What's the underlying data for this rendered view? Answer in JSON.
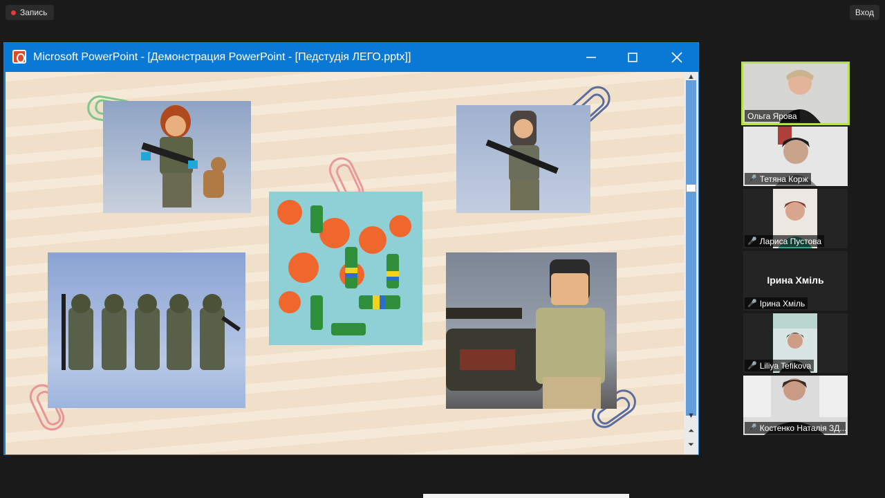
{
  "meeting": {
    "record_label": "Запись",
    "enter_label": "Вход"
  },
  "window": {
    "title": "Microsoft PowerPoint - [Демонстрация PowerPoint - [Педстудія ЛЕГО.pptx]]",
    "minimize_icon": "minimize-icon",
    "maximize_icon": "maximize-icon",
    "close_icon": "close-icon"
  },
  "participants": [
    {
      "name": "Ольга Ярова",
      "muted": false,
      "active": true
    },
    {
      "name": "Тетяна Корж",
      "muted": true
    },
    {
      "name": "Лариса Пустова",
      "muted": true
    },
    {
      "name": "Ірина Хміль",
      "muted": true,
      "no_video": true
    },
    {
      "name": "Liliya Tefikova",
      "muted": true
    },
    {
      "name": "Костенко Наталія ЗД...",
      "muted": true
    }
  ],
  "colors": {
    "titlebar": "#0a79d6",
    "slide_bg": "#f3e4cf",
    "rec_dot": "#e5383b",
    "muted_mic": "#e53935",
    "active_speaker_border": "#b8e04a"
  }
}
